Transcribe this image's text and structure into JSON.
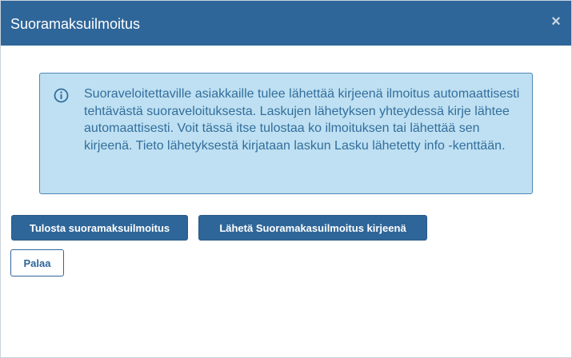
{
  "dialog": {
    "title": "Suoramaksuilmoitus",
    "close_symbol": "×",
    "info_icon": "info-circle-icon",
    "info_text": "Suoraveloitettaville asiakkaille tulee lähettää kirjeenä ilmoitus automaattisesti tehtävästä suoraveloituksesta. Laskujen lähetyksen yhteydessä kirje lähtee automaattisesti. Voit tässä itse tulostaa ko ilmoituksen tai lähettää sen kirjeenä. Tieto lähetyksestä kirjataan laskun Lasku lähetetty info -kenttään.",
    "buttons": {
      "print_label": "Tulosta suoramaksuilmoitus",
      "send_label": "Lähetä Suoramakasuilmoitus kirjeenä",
      "back_label": "Palaa"
    }
  },
  "colors": {
    "header_bg": "#2f6699",
    "info_bg": "#bee0f2",
    "info_border": "#4f87b4",
    "info_text": "#336e9c"
  }
}
